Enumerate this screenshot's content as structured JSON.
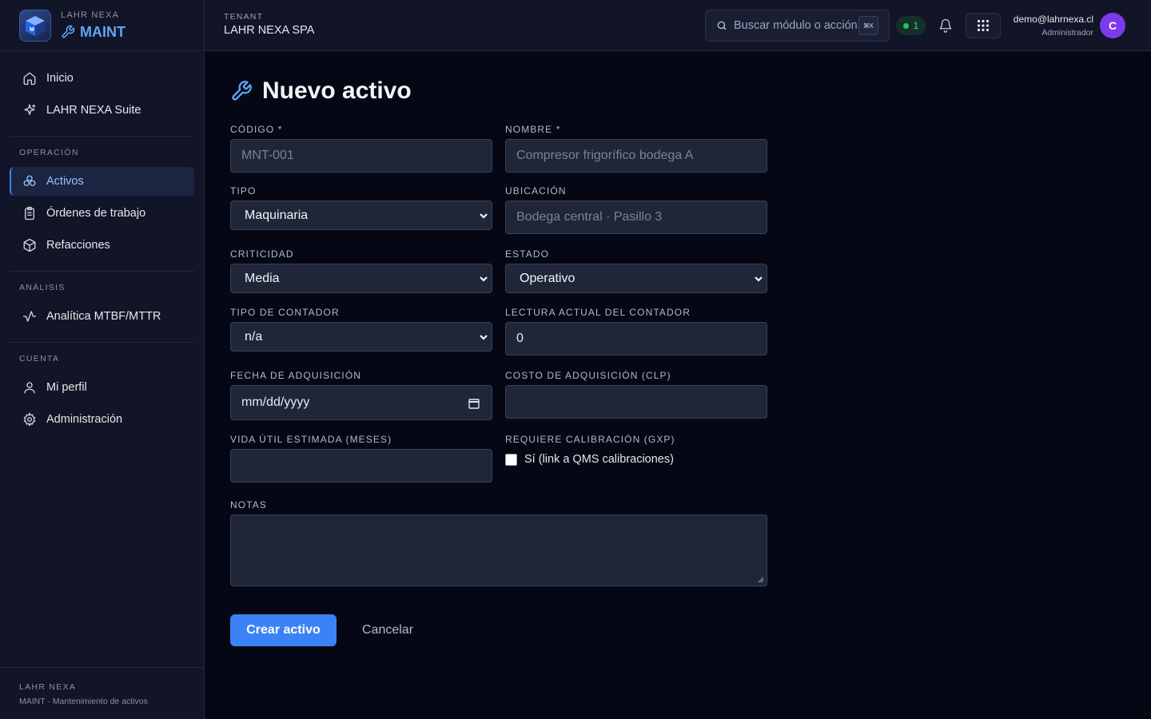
{
  "brand": {
    "company": "LAHR NEXA",
    "product": "MAINT"
  },
  "sidebar": {
    "top_items": [
      {
        "label": "Inicio",
        "icon": "home-icon"
      },
      {
        "label": "LAHR NEXA Suite",
        "icon": "sparkle-icon"
      }
    ],
    "sections": [
      {
        "title": "OPERACIÓN",
        "items": [
          {
            "label": "Activos",
            "icon": "assets-icon",
            "active": true
          },
          {
            "label": "Órdenes de trabajo",
            "icon": "clipboard-icon"
          },
          {
            "label": "Refacciones",
            "icon": "box-icon"
          }
        ]
      },
      {
        "title": "ANÁLISIS",
        "items": [
          {
            "label": "Analítica MTBF/MTTR",
            "icon": "activity-icon"
          }
        ]
      },
      {
        "title": "CUENTA",
        "items": [
          {
            "label": "Mi perfil",
            "icon": "user-icon"
          },
          {
            "label": "Administración",
            "icon": "gear-icon"
          }
        ]
      }
    ],
    "footer": {
      "title": "LAHR NEXA",
      "subtitle": "MAINT · Mantenimiento de activos"
    }
  },
  "topbar": {
    "tenant_label": "TENANT",
    "tenant_name": "LAHR NEXA SPA",
    "search_placeholder": "Buscar módulo o acción",
    "search_shortcut": "⌘K",
    "status_count": "1",
    "user_email": "demo@lahrnexa.cl",
    "user_role": "Administrador",
    "avatar_initial": "C"
  },
  "page": {
    "title": "Nuevo activo"
  },
  "form": {
    "codigo": {
      "label": "CÓDIGO *",
      "placeholder": "MNT-001",
      "value": ""
    },
    "nombre": {
      "label": "NOMBRE *",
      "placeholder": "Compresor frigorífico bodega A",
      "value": ""
    },
    "tipo": {
      "label": "TIPO",
      "value": "Maquinaria"
    },
    "ubicacion": {
      "label": "UBICACIÓN",
      "placeholder": "Bodega central · Pasillo 3",
      "value": ""
    },
    "criticidad": {
      "label": "CRITICIDAD",
      "value": "Media"
    },
    "estado": {
      "label": "ESTADO",
      "value": "Operativo"
    },
    "tipo_contador": {
      "label": "TIPO DE CONTADOR",
      "value": "n/a"
    },
    "lectura": {
      "label": "LECTURA ACTUAL DEL CONTADOR",
      "value": "0"
    },
    "fecha": {
      "label": "FECHA DE ADQUISICIÓN",
      "value": "mm/dd/yyyy"
    },
    "costo": {
      "label": "COSTO DE ADQUISICIÓN (CLP)",
      "value": ""
    },
    "vida_util": {
      "label": "VIDA ÚTIL ESTIMADA (MESES)",
      "value": ""
    },
    "calibracion": {
      "label": "REQUIERE CALIBRACIÓN (GXP)",
      "checkbox_label": "Sí (link a QMS calibraciones)",
      "checked": false
    },
    "notas": {
      "label": "NOTAS",
      "value": ""
    },
    "submit_label": "Crear activo",
    "cancel_label": "Cancelar"
  },
  "colors": {
    "accent": "#3b82f6",
    "sidebar_bg": "#121527",
    "page_bg": "#050814",
    "avatar": "#7c3aed",
    "status_ok": "#22c55e"
  }
}
